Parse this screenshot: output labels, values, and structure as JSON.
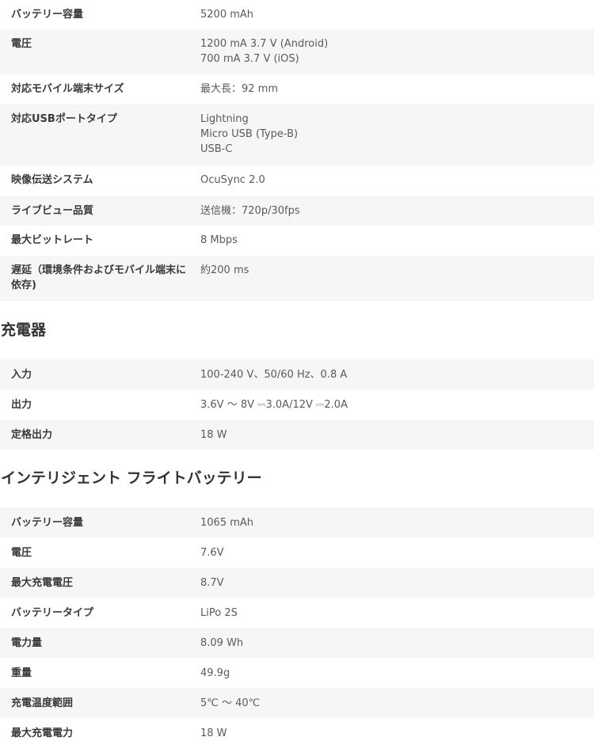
{
  "section1": {
    "rows": [
      {
        "label": "バッテリー容量",
        "values": [
          "5200 mAh"
        ]
      },
      {
        "label": "電圧",
        "values": [
          "1200 mA 3.7 V (Android)",
          "700 mA 3.7 V (iOS)"
        ]
      },
      {
        "label": "対応モバイル端末サイズ",
        "values": [
          "最大長：92 mm"
        ]
      },
      {
        "label": "対応USBポートタイプ",
        "values": [
          "Lightning",
          "Micro USB (Type-B)",
          "USB-C"
        ]
      },
      {
        "label": "映像伝送システム",
        "values": [
          "OcuSync 2.0"
        ]
      },
      {
        "label": "ライブビュー品質",
        "values": [
          "送信機：720p/30fps"
        ]
      },
      {
        "label": "最大ビットレート",
        "values": [
          "8 Mbps"
        ]
      },
      {
        "label": "遅延（環境条件およびモバイル端末に依存)",
        "values": [
          "約200 ms"
        ]
      }
    ]
  },
  "charger": {
    "title": "充電器",
    "rows": [
      {
        "label": "入力",
        "values": [
          "100-240 V、50/60 Hz、0.8 A"
        ]
      },
      {
        "label": "出力",
        "values": [
          "3.6V ～ 8V ⎓3.0A/12V ⎓2.0A"
        ]
      },
      {
        "label": "定格出力",
        "values": [
          "18 W"
        ]
      }
    ]
  },
  "battery": {
    "title": "インテリジェント フライトバッテリー",
    "rows": [
      {
        "label": "バッテリー容量",
        "values": [
          "1065 mAh"
        ]
      },
      {
        "label": "電圧",
        "values": [
          "7.6V"
        ]
      },
      {
        "label": "最大充電電圧",
        "values": [
          "8.7V"
        ]
      },
      {
        "label": "バッテリータイプ",
        "values": [
          "LiPo 2S"
        ]
      },
      {
        "label": "電力量",
        "values": [
          "8.09 Wh"
        ]
      },
      {
        "label": "重量",
        "values": [
          "49.9g"
        ]
      },
      {
        "label": "充電温度範囲",
        "values": [
          "5℃ ～ 40℃"
        ]
      },
      {
        "label": "最大充電電力",
        "values": [
          "18 W"
        ]
      }
    ]
  }
}
